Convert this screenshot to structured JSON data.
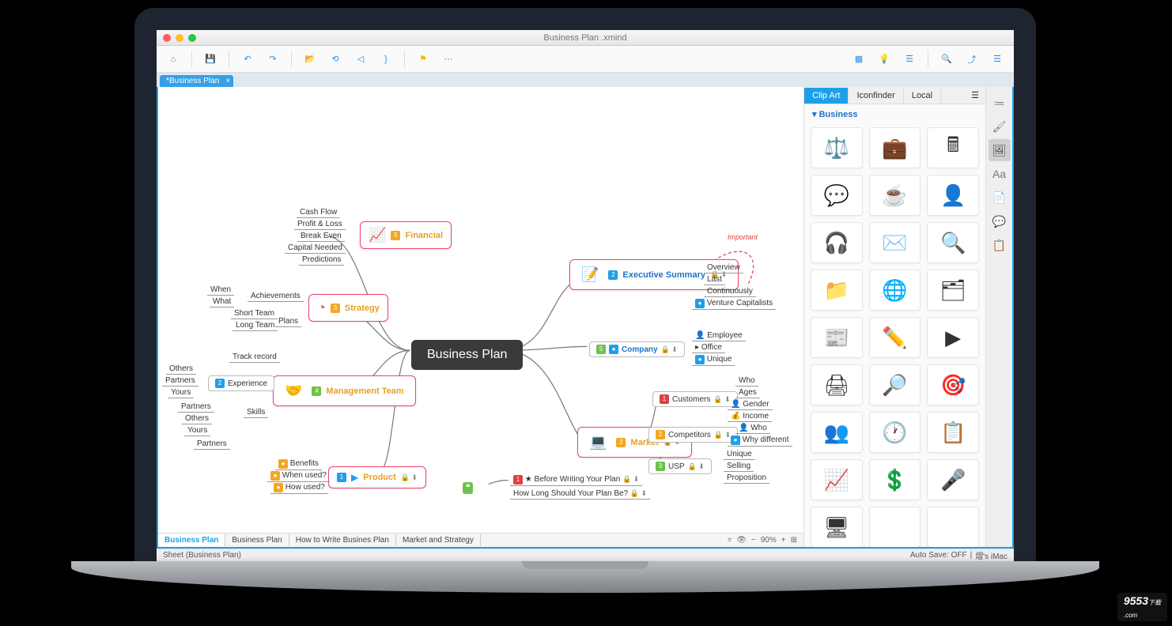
{
  "window": {
    "title": "Business Plan .xmind"
  },
  "doc_tab": {
    "label": "*Business Plan"
  },
  "toolbar_icons": {
    "home": "⌂",
    "save": "💾",
    "undo": "↶",
    "redo": "↷",
    "open": "📂",
    "refresh": "⟲",
    "tag": "◁",
    "brace": "}",
    "flag": "⚑",
    "more": "⋯",
    "present": "▦",
    "bulb": "💡",
    "layout": "☰",
    "search": "🔍",
    "share": "⤴",
    "panel": "☰"
  },
  "root": {
    "label": "Business Plan"
  },
  "nodes": {
    "financial": {
      "label": "Financial",
      "icon": "📈"
    },
    "strategy": {
      "label": "Strategy",
      "icon": "◔"
    },
    "management": {
      "label": "Management Team",
      "icon": "🤝"
    },
    "product": {
      "label": "Product",
      "icon": "▶"
    },
    "summary": {
      "label": "Executive Summary",
      "icon": "📝"
    },
    "company": {
      "label": "Company"
    },
    "market": {
      "label": "Market",
      "icon": "💻"
    },
    "customers": {
      "label": "Customers"
    },
    "competitors": {
      "label": "Competitors"
    },
    "usp": {
      "label": "USP"
    }
  },
  "leaves": {
    "financial": [
      "Cash Flow",
      "Profit & Loss",
      "Break Even",
      "Capital Needed",
      "Predictions"
    ],
    "strategy_left": [
      "When",
      "What",
      "Short Team",
      "Long Team"
    ],
    "strategy_right": [
      "Achievements",
      "Plans"
    ],
    "experience": "Experience",
    "track_record": "Track record",
    "mgmt": [
      "Others",
      "Partners",
      "Yours",
      "Partners",
      "Others",
      "Yours",
      "Partners"
    ],
    "skills": "Skills",
    "product": [
      "Benefits",
      "When used?",
      "How used?"
    ],
    "summary": [
      "Overview",
      "Last",
      "Continuously",
      "Venture Capitalists"
    ],
    "company": [
      "Employee",
      "Office",
      "Unique"
    ],
    "customers": [
      "Who",
      "Ages",
      "Gender",
      "Income"
    ],
    "competitors": [
      "Who",
      "Why different"
    ],
    "usp": [
      "Unique",
      "Selling",
      "Proposition"
    ],
    "before": "Before Writing Your Plan",
    "howlong": "How Long Should Your Plan Be?",
    "important": "Important"
  },
  "clipart": {
    "tabs": [
      "Clip Art",
      "Iconfinder",
      "Local"
    ],
    "section": "Business",
    "items": [
      "⚖️",
      "💼",
      "🖩",
      "💬",
      "☕",
      "👤",
      "🎧",
      "✉️",
      "🔍",
      "📁",
      "🌐",
      "🗂",
      "📰",
      "✏️",
      "▶",
      "🖨",
      "🔎",
      "🎯",
      "👥",
      "🕐",
      "📋",
      "📈",
      "💲",
      "🎤",
      "🖥",
      " ",
      " "
    ]
  },
  "rail": [
    "≔",
    "🖌",
    "🖼",
    "Aa",
    "📄",
    "💬",
    "📋"
  ],
  "sheets": {
    "tabs": [
      "Business Plan",
      "Business Plan",
      "How to Write Busines Plan",
      "Market and Strategy"
    ],
    "zoom": "90%"
  },
  "status": {
    "sheet": "Sheet (Business Plan)",
    "autosave": "Auto Save: OFF",
    "user": "熠's iMac"
  },
  "watermark": "9553"
}
